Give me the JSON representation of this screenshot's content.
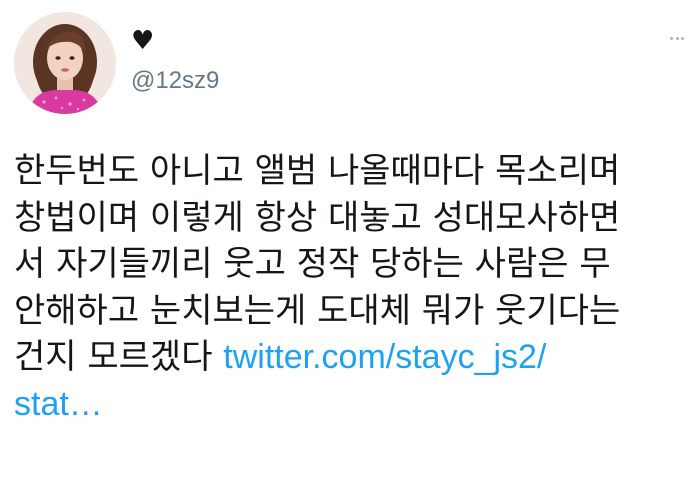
{
  "author": {
    "display_name": "♥",
    "handle": "@12sz9",
    "avatar_icon": "profile-photo"
  },
  "menu": {
    "icon": "more-dots-icon"
  },
  "tweet": {
    "lines": [
      "한두번도 아니고 앨범 나올때마다 목소리며",
      "창법이며 이렇게 항상 대놓고 성대모사하면",
      "서 자기들끼리 웃고 정작 당하는 사람은 무",
      "안해하고 눈치보는게 도대체 뭐가 웃기다는"
    ],
    "last_line_text": "건지 모르겠다 ",
    "link_part1": "twitter.com/stayc_js2/",
    "link_part2": "stat…"
  },
  "colors": {
    "text": "#14171a",
    "secondary": "#657786",
    "link": "#1da1f2",
    "background": "#ffffff"
  }
}
